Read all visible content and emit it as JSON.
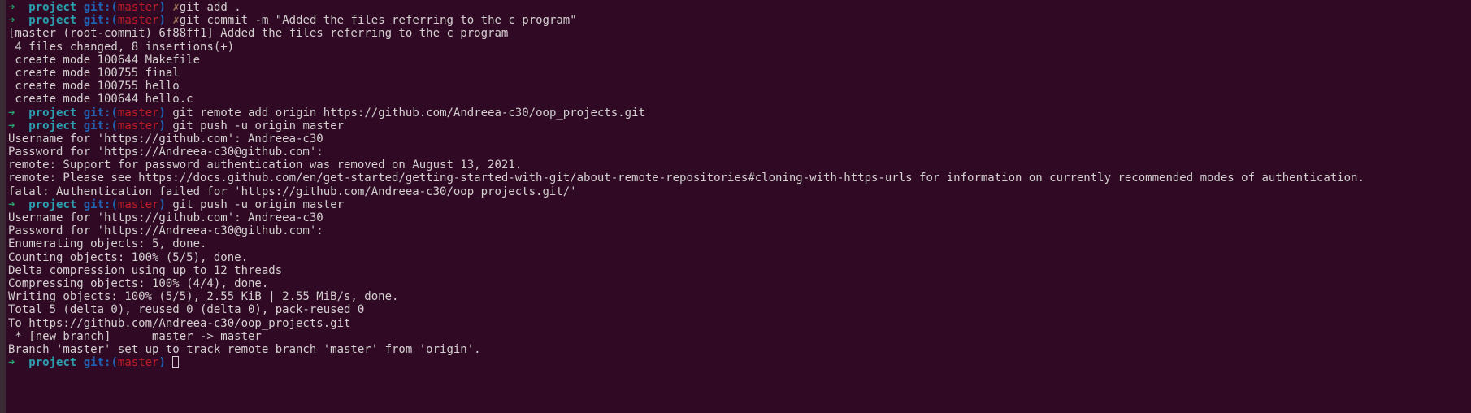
{
  "prompt": {
    "arrow": "➜",
    "dir": "project",
    "git_open": "git:(",
    "branch": "master",
    "git_close": ")",
    "dirty_mark": "✗"
  },
  "lines": [
    {
      "prompt": true,
      "dirty": true,
      "cmd": "git add ."
    },
    {
      "prompt": true,
      "dirty": true,
      "cmd": "git commit -m \"Added the files referring to the c program\""
    },
    {
      "text": "[master (root-commit) 6f88ff1] Added the files referring to the c program"
    },
    {
      "text": " 4 files changed, 8 insertions(+)"
    },
    {
      "text": " create mode 100644 Makefile"
    },
    {
      "text": " create mode 100755 final"
    },
    {
      "text": " create mode 100755 hello"
    },
    {
      "text": " create mode 100644 hello.c"
    },
    {
      "prompt": true,
      "dirty": false,
      "cmd": "git remote add origin https://github.com/Andreea-c30/oop_projects.git"
    },
    {
      "prompt": true,
      "dirty": false,
      "cmd": "git push -u origin master"
    },
    {
      "text": "Username for 'https://github.com': Andreea-c30"
    },
    {
      "text": "Password for 'https://Andreea-c30@github.com':"
    },
    {
      "text": "remote: Support for password authentication was removed on August 13, 2021."
    },
    {
      "text": "remote: Please see https://docs.github.com/en/get-started/getting-started-with-git/about-remote-repositories#cloning-with-https-urls for information on currently recommended modes of authentication."
    },
    {
      "text": "fatal: Authentication failed for 'https://github.com/Andreea-c30/oop_projects.git/'"
    },
    {
      "prompt": true,
      "dirty": false,
      "cmd": "git push -u origin master"
    },
    {
      "text": "Username for 'https://github.com': Andreea-c30"
    },
    {
      "text": "Password for 'https://Andreea-c30@github.com':"
    },
    {
      "text": "Enumerating objects: 5, done."
    },
    {
      "text": "Counting objects: 100% (5/5), done."
    },
    {
      "text": "Delta compression using up to 12 threads"
    },
    {
      "text": "Compressing objects: 100% (4/4), done."
    },
    {
      "text": "Writing objects: 100% (5/5), 2.55 KiB | 2.55 MiB/s, done."
    },
    {
      "text": "Total 5 (delta 0), reused 0 (delta 0), pack-reused 0"
    },
    {
      "text": "To https://github.com/Andreea-c30/oop_projects.git"
    },
    {
      "text": " * [new branch]      master -> master"
    },
    {
      "text": "Branch 'master' set up to track remote branch 'master' from 'origin'."
    },
    {
      "prompt": true,
      "dirty": false,
      "cmd": "",
      "cursor": true
    }
  ]
}
